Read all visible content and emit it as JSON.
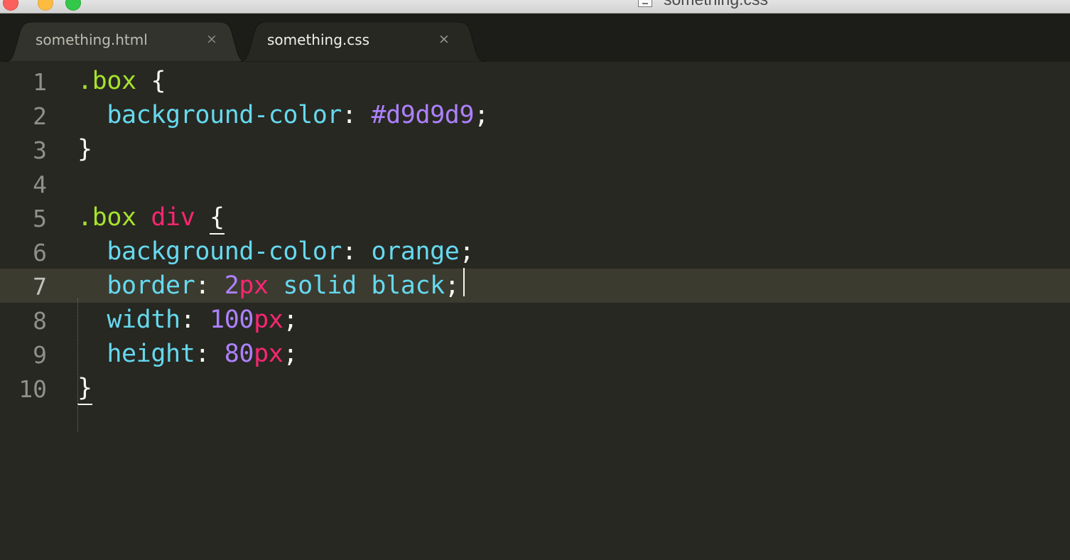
{
  "window": {
    "title": "something.css",
    "controls": [
      "close",
      "minimize",
      "zoom"
    ]
  },
  "tabs": [
    {
      "label": "something.html",
      "close_glyph": "×",
      "active": false
    },
    {
      "label": "something.css",
      "close_glyph": "×",
      "active": true
    }
  ],
  "editor": {
    "current_line": 7,
    "lines": [
      {
        "num": "1",
        "tokens": {
          "t1": ".box",
          "t2": " {"
        }
      },
      {
        "num": "2",
        "tokens": {
          "t1": "  background-color",
          "t2": ": ",
          "t3": "#d9d9d9",
          "t4": ";"
        }
      },
      {
        "num": "3",
        "tokens": {
          "t1": "}"
        }
      },
      {
        "num": "4",
        "tokens": {}
      },
      {
        "num": "5",
        "tokens": {
          "t1": ".box",
          "t2": " ",
          "t3": "div",
          "t4": " ",
          "t5": "{"
        }
      },
      {
        "num": "6",
        "tokens": {
          "t1": "  background-color",
          "t2": ": ",
          "t3": "orange",
          "t4": ";"
        }
      },
      {
        "num": "7",
        "tokens": {
          "t1": "  border",
          "t2": ": ",
          "t3": "2",
          "t4": "px",
          "t5": " ",
          "t6": "solid black",
          "t7": ";"
        }
      },
      {
        "num": "8",
        "tokens": {
          "t1": "  width",
          "t2": ": ",
          "t3": "100",
          "t4": "px",
          "t5": ";"
        }
      },
      {
        "num": "9",
        "tokens": {
          "t1": "  height",
          "t2": ": ",
          "t3": "80",
          "t4": "px",
          "t5": ";"
        }
      },
      {
        "num": "10",
        "tokens": {
          "t1": "}"
        }
      }
    ]
  },
  "colors": {
    "background": "#272822",
    "tabbar": "#1c1c19",
    "selector": "#a6e22e",
    "tag": "#f92672",
    "property": "#66d9ef",
    "number": "#ae81ff",
    "unit": "#f92672",
    "text": "#f8f8f2",
    "current_line": "#3c3b30"
  }
}
